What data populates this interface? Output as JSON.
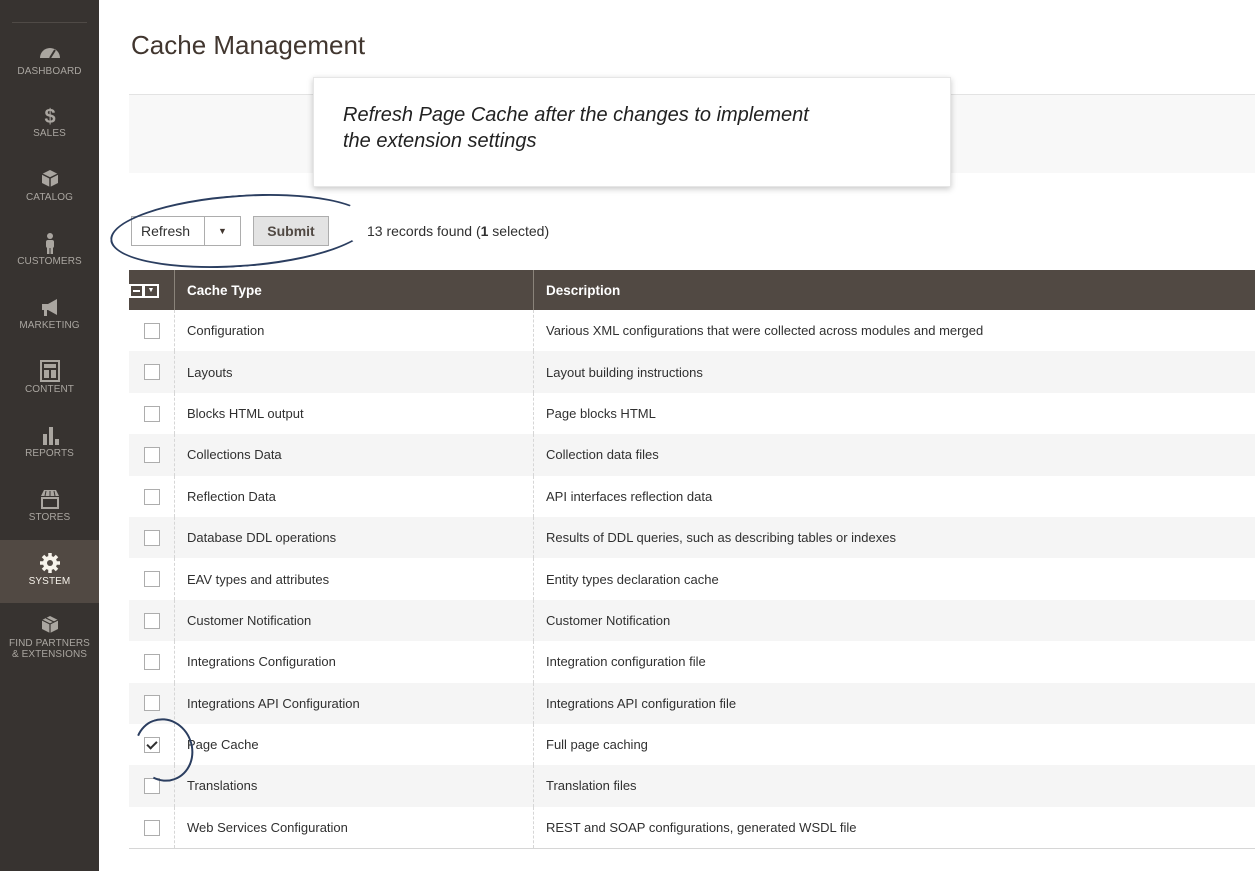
{
  "sidebar": {
    "items": [
      {
        "label": "DASHBOARD",
        "icon": "gauge-icon"
      },
      {
        "label": "SALES",
        "icon": "dollar-icon"
      },
      {
        "label": "CATALOG",
        "icon": "box-icon"
      },
      {
        "label": "CUSTOMERS",
        "icon": "person-icon"
      },
      {
        "label": "MARKETING",
        "icon": "megaphone-icon"
      },
      {
        "label": "CONTENT",
        "icon": "layout-icon"
      },
      {
        "label": "REPORTS",
        "icon": "bar-chart-icon"
      },
      {
        "label": "STORES",
        "icon": "storefront-icon"
      },
      {
        "label": "SYSTEM",
        "icon": "gear-icon"
      },
      {
        "label1": "FIND PARTNERS",
        "label2": "& EXTENSIONS",
        "icon": "cubes-icon"
      }
    ]
  },
  "page": {
    "title": "Cache Management"
  },
  "tooltip": {
    "line1": "Refresh Page Cache after the changes to implement",
    "line2": "the extension settings"
  },
  "toolbar": {
    "action_value": "Refresh",
    "submit_label": "Submit",
    "records_prefix": "13 records found (",
    "records_selected": "1",
    "records_suffix": " selected)"
  },
  "table": {
    "headers": {
      "cache_type": "Cache Type",
      "description": "Description"
    },
    "rows": [
      {
        "type": "Configuration",
        "desc": "Various XML configurations that were collected across modules and merged",
        "checked": false
      },
      {
        "type": "Layouts",
        "desc": "Layout building instructions",
        "checked": false
      },
      {
        "type": "Blocks HTML output",
        "desc": "Page blocks HTML",
        "checked": false
      },
      {
        "type": "Collections Data",
        "desc": "Collection data files",
        "checked": false
      },
      {
        "type": "Reflection Data",
        "desc": "API interfaces reflection data",
        "checked": false
      },
      {
        "type": "Database DDL operations",
        "desc": "Results of DDL queries, such as describing tables or indexes",
        "checked": false
      },
      {
        "type": "EAV types and attributes",
        "desc": "Entity types declaration cache",
        "checked": false
      },
      {
        "type": "Customer Notification",
        "desc": "Customer Notification",
        "checked": false
      },
      {
        "type": "Integrations Configuration",
        "desc": "Integration configuration file",
        "checked": false
      },
      {
        "type": "Integrations API Configuration",
        "desc": "Integrations API configuration file",
        "checked": false
      },
      {
        "type": "Page Cache",
        "desc": "Full page caching",
        "checked": true
      },
      {
        "type": "Translations",
        "desc": "Translation files",
        "checked": false
      },
      {
        "type": "Web Services Configuration",
        "desc": "REST and SOAP configurations, generated WSDL file",
        "checked": false
      }
    ]
  }
}
